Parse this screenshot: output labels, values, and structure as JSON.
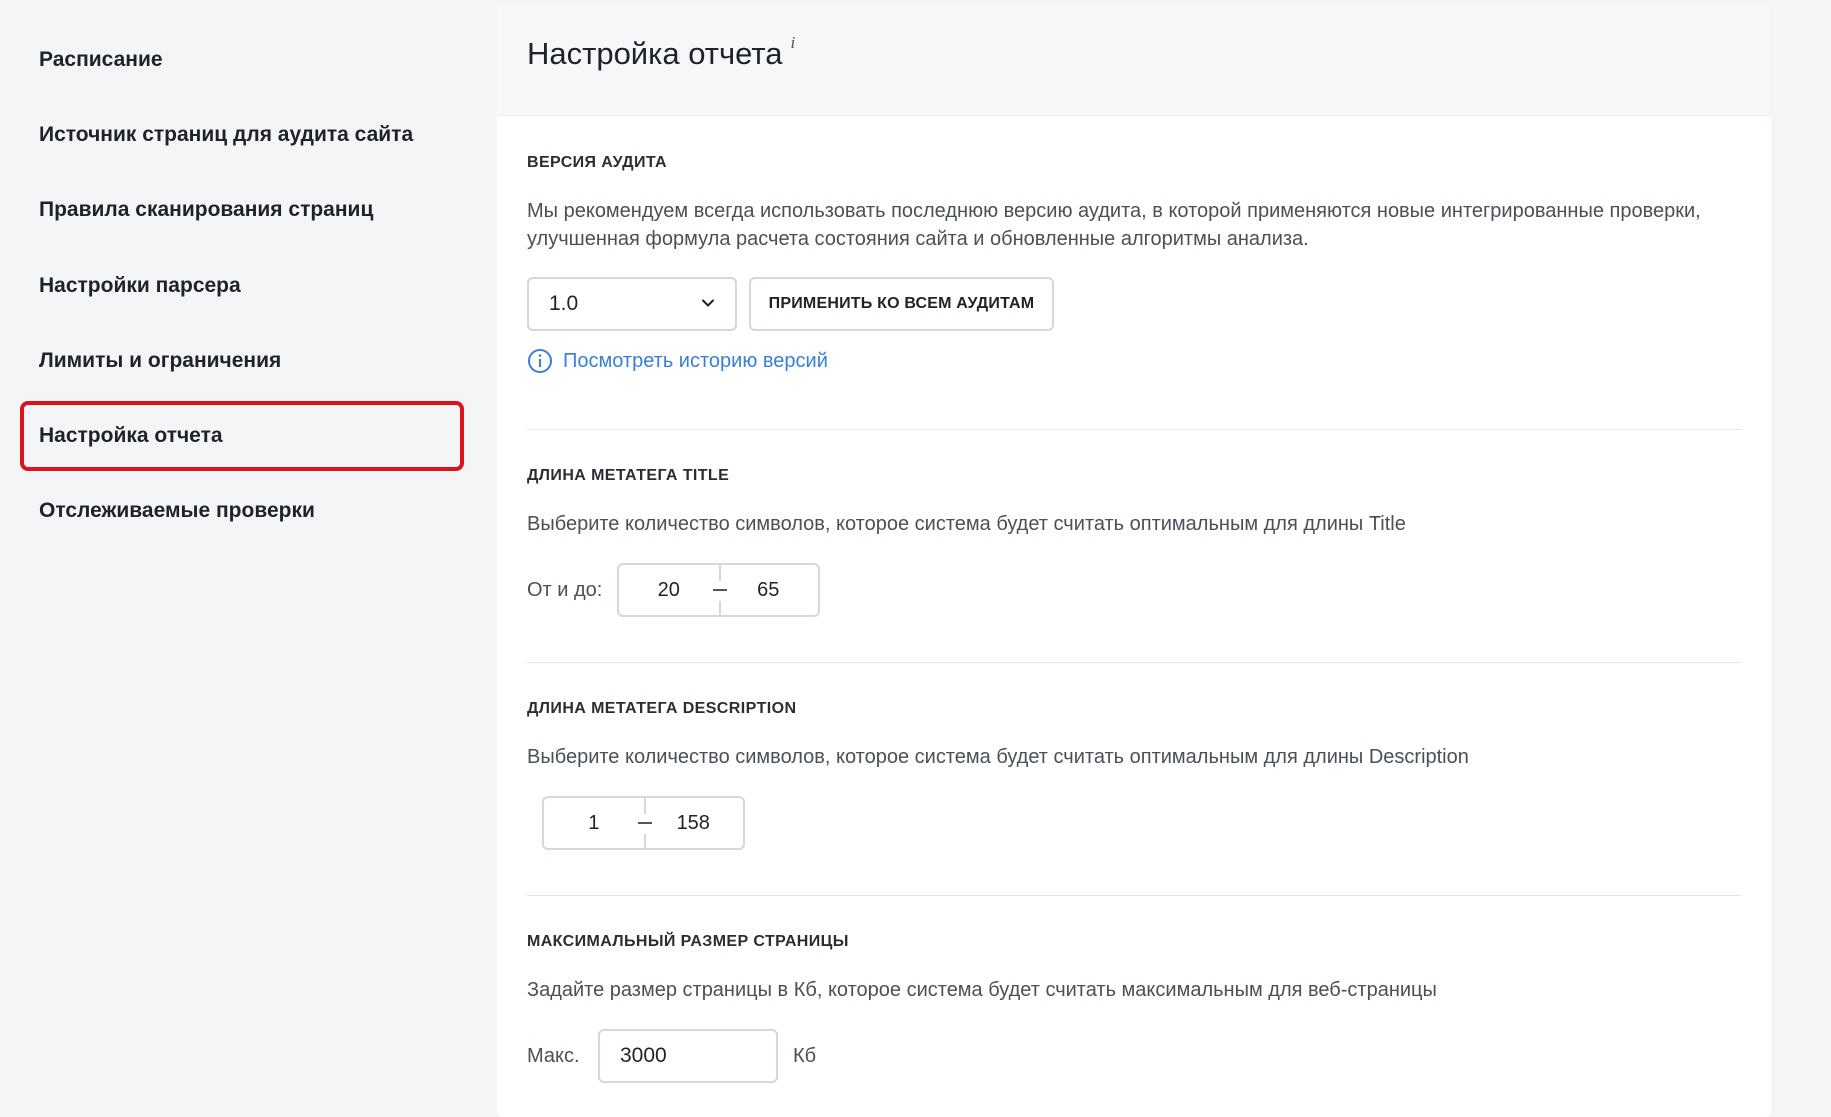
{
  "sidebar": {
    "items": [
      {
        "label": "Расписание"
      },
      {
        "label": "Источник страниц для аудита сайта"
      },
      {
        "label": "Правила сканирования страниц"
      },
      {
        "label": "Настройки парсера"
      },
      {
        "label": "Лимиты и ограничения"
      },
      {
        "label": "Настройка отчета",
        "active": true
      },
      {
        "label": "Отслеживаемые проверки"
      }
    ]
  },
  "header": {
    "title": "Настройка отчета",
    "info_mark": "i"
  },
  "audit_version": {
    "title": "ВЕРСИЯ АУДИТА",
    "description": "Мы рекомендуем всегда использовать последнюю версию аудита, в которой применяются новые интегрированные проверки, улучшенная формула расчета состояния сайта и обновленные алгоритмы анализа.",
    "selected_version": "1.0",
    "apply_button": "ПРИМЕНИТЬ КО ВСЕМ АУДИТАМ",
    "history_link": "Посмотреть историю версий"
  },
  "title_length": {
    "title": "ДЛИНА МЕТАТЕГА TITLE",
    "description": "Выберите количество символов, которое система будет считать оптимальным для длины Title",
    "range_label": "От и до:",
    "from": "20",
    "to": "65"
  },
  "description_length": {
    "title": "ДЛИНА МЕТАТЕГА DESCRIPTION",
    "description": "Выберите количество символов, которое система будет считать оптимальным для длины Description",
    "from": "1",
    "to": "158"
  },
  "max_page_size": {
    "title": "МАКСИМАЛЬНЫЙ РАЗМЕР СТРАНИЦЫ",
    "description": "Задайте размер страницы в Кб, которое система будет считать максимальным для веб-страницы",
    "label": "Макс.",
    "value": "3000",
    "unit": "Кб"
  }
}
